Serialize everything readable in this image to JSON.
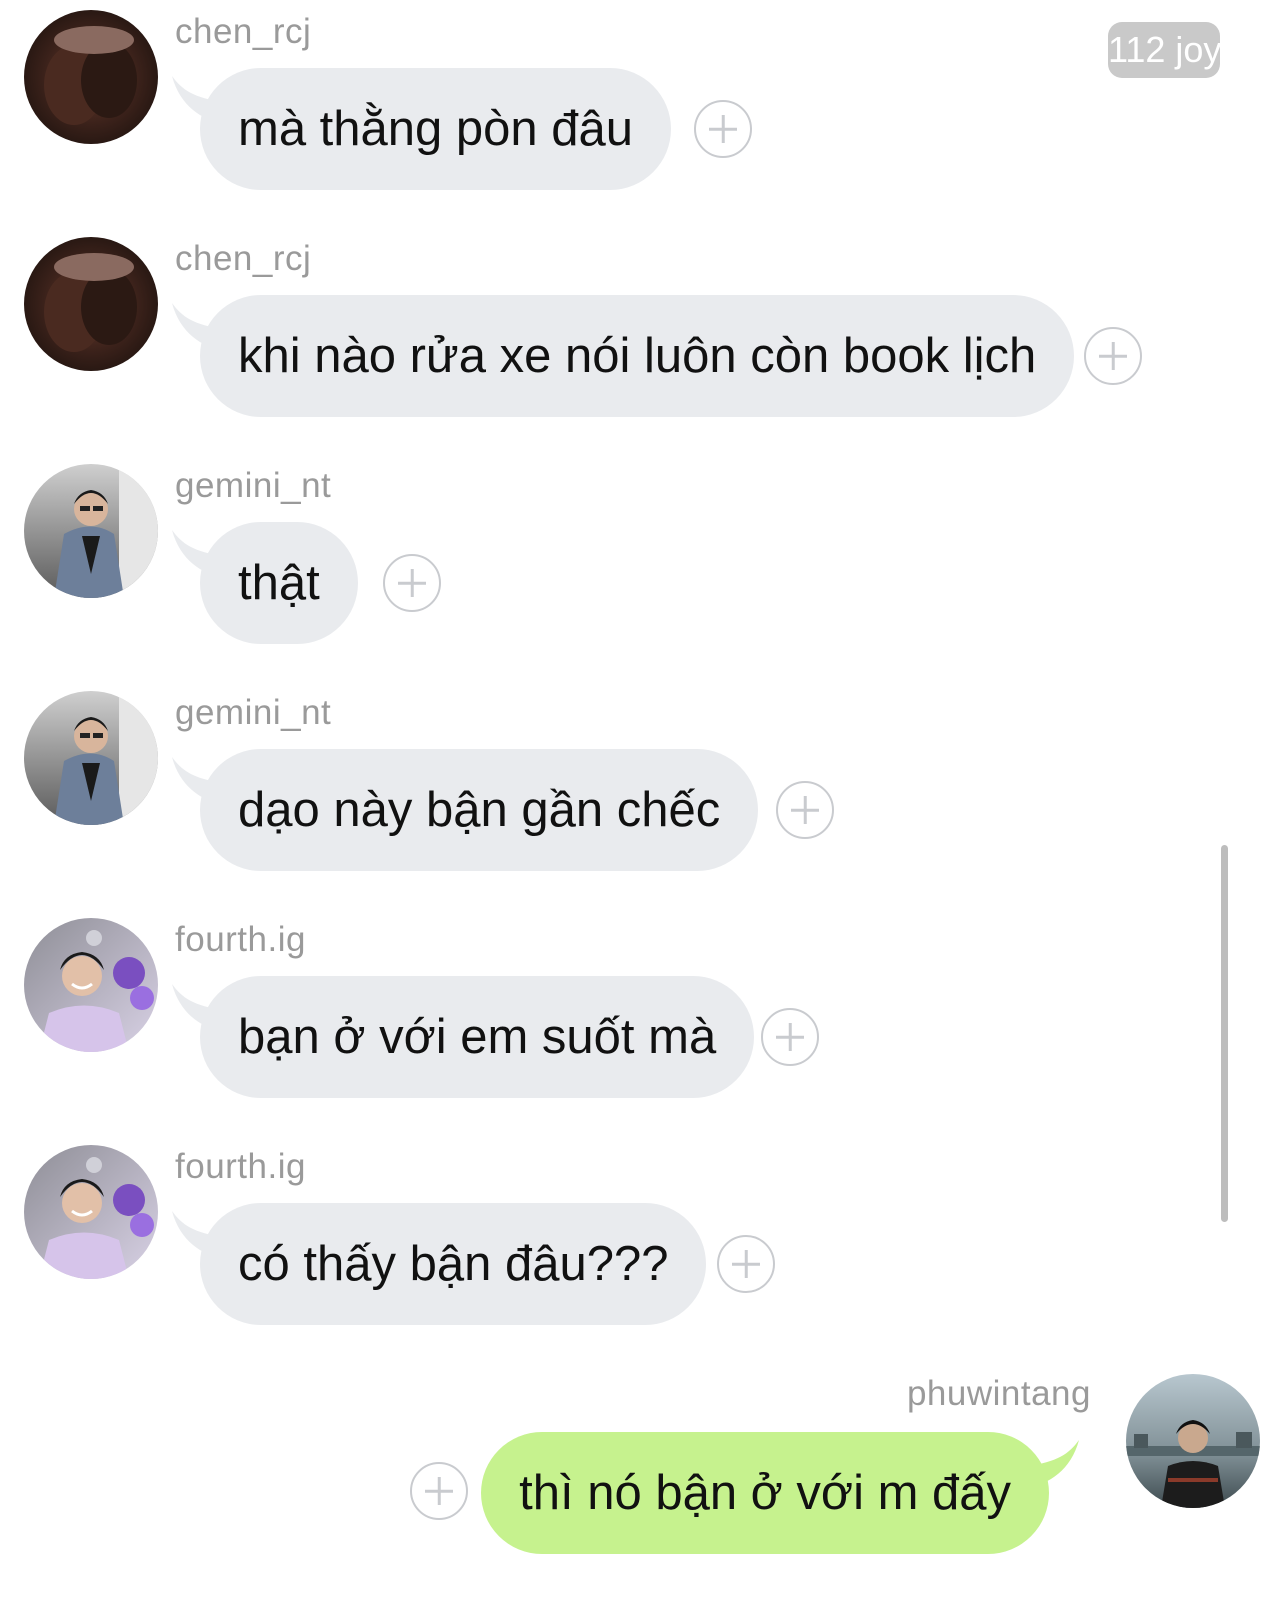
{
  "badge": "112 joy",
  "messages": [
    {
      "sender": "chen_rcj",
      "text": "mà thằng pòn đâu"
    },
    {
      "sender": "chen_rcj",
      "text": "khi nào rửa xe nói luôn còn book lịch"
    },
    {
      "sender": "gemini_nt",
      "text": "thật"
    },
    {
      "sender": "gemini_nt",
      "text": "dạo này bận gần chếc"
    },
    {
      "sender": "fourth.ig",
      "text": "bạn ở với em suốt mà"
    },
    {
      "sender": "fourth.ig",
      "text": "có thấy bận đâu???"
    },
    {
      "sender": "phuwintang",
      "text": "thì nó bận ở với m đấy"
    }
  ],
  "colors": {
    "incoming_bubble": "#e9ebee",
    "outgoing_bubble": "#c6f28e",
    "username": "#9a9a9a",
    "add_icon": "#c9cbcf"
  },
  "icons": {
    "add": "plus-circle-icon",
    "avatars": [
      "avatar-photo",
      "avatar-photo",
      "avatar-photo",
      "avatar-photo",
      "avatar-photo",
      "avatar-photo",
      "avatar-photo"
    ]
  }
}
